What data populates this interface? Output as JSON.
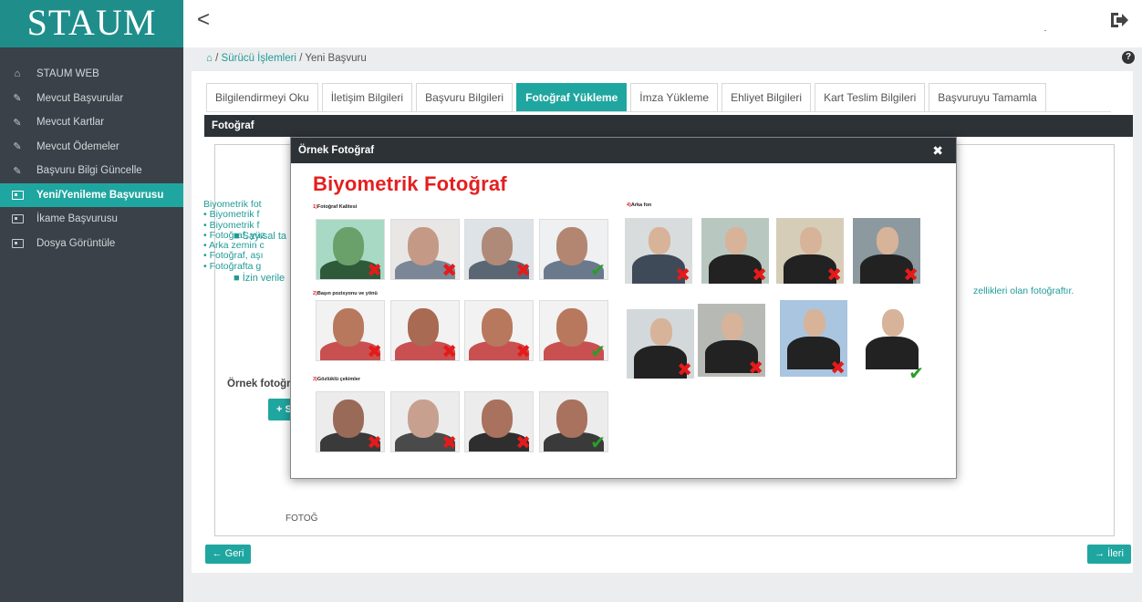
{
  "brand": "STAUM",
  "sidebar": {
    "items": [
      {
        "label": "STAUM WEB",
        "icon": "home-icon"
      },
      {
        "label": "Mevcut Başvurular",
        "icon": "edit-icon"
      },
      {
        "label": "Mevcut Kartlar",
        "icon": "edit-icon"
      },
      {
        "label": "Mevcut Ödemeler",
        "icon": "edit-icon"
      },
      {
        "label": "Başvuru Bilgi Güncelle",
        "icon": "edit-icon"
      },
      {
        "label": "Yeni/Yenileme Başvurusu",
        "icon": "id-card-icon",
        "active": true
      },
      {
        "label": "İkame Başvurusu",
        "icon": "id-card-icon"
      },
      {
        "label": "Dosya Görüntüle",
        "icon": "id-card-icon"
      }
    ]
  },
  "topbar": {
    "back_label": "<"
  },
  "breadcrumb": {
    "home_icon": "home-icon",
    "sep1": " / ",
    "link": "Sürücü İşlemleri",
    "sep2": " / ",
    "current": "Yeni Başvuru"
  },
  "help_label": "?",
  "tabs": [
    {
      "label": "Bilgilendirmeyi Oku"
    },
    {
      "label": "İletişim Bilgileri"
    },
    {
      "label": "Başvuru Bilgileri"
    },
    {
      "label": "Fotoğraf Yükleme",
      "active": true
    },
    {
      "label": "İmza Yükleme"
    },
    {
      "label": "Ehliyet Bilgileri"
    },
    {
      "label": "Kart Teslim Bilgileri"
    },
    {
      "label": "Başvuruyu Tamamla"
    }
  ],
  "section_header": "Fotoğraf",
  "content": {
    "sayisal": "Sayısal ta",
    "izin": "İzin verile",
    "bio_lines": [
      "Biyometrik fot",
      "• Biyometrik f",
      "• Biyometrik f",
      "• Fotoğraf, yüz",
      "• Arka zemin c",
      "• Fotoğraf, aşı",
      "• Fotoğrafta g"
    ],
    "right_text": "zellikleri olan fotoğraftır.",
    "ornek_title": "Örnek fotoğr",
    "sec_button": "+ Seç",
    "fotog_label": "FOTOĞ"
  },
  "nav": {
    "back": "← Geri",
    "next": "→ İleri"
  },
  "modal": {
    "title": "Örnek Fotoğraf",
    "close": "✖",
    "heading": "Biyometrik Fotoğraf",
    "sections": {
      "quality": {
        "num": "1)",
        "label": "Fotoğraf Kalitesi"
      },
      "head_pos": {
        "num": "2)",
        "label": "Başın pozisyonu ve yönü"
      },
      "glasses": {
        "num": "3)",
        "label": "Gözlüklü çekimler"
      },
      "background": {
        "num": "4)",
        "label": "Arka fon"
      }
    },
    "marks": {
      "wrong": "✖",
      "right": "✔"
    }
  },
  "colors": {
    "accent": "#20a6a0",
    "sidebar": "#3a4148",
    "header_dark": "#2d3237",
    "error": "#e41f1f",
    "ok": "#2a9d2a"
  }
}
